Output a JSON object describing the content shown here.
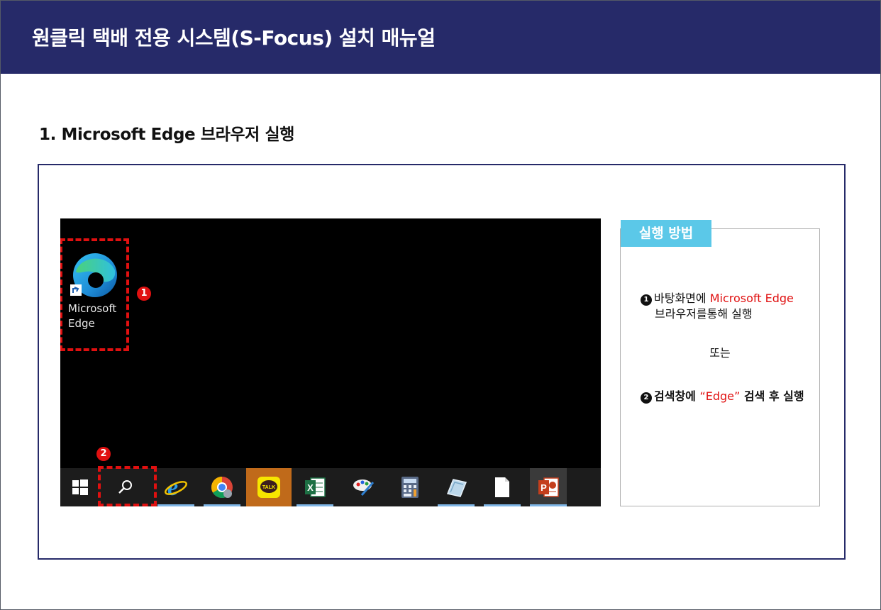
{
  "header": {
    "title": "원클릭 택배 전용 시스템(S-Focus) 설치 매뉴얼"
  },
  "section": {
    "title": "1. Microsoft Edge 브라우저 실행"
  },
  "desktop": {
    "shortcut_label": "Microsoft\nEdge",
    "marker1": "1",
    "marker2": "2"
  },
  "taskbar": {
    "items": [
      "windows-start",
      "search",
      "internet-explorer",
      "chrome",
      "kakaotalk",
      "excel",
      "paint",
      "calculator",
      "notes",
      "notepad",
      "powerpoint"
    ],
    "kakao_label": "TALK",
    "excel_letter": "X",
    "ppt_letter": "P"
  },
  "info": {
    "tab_label": "실행 방법",
    "step1_num": "1",
    "step1_prefix": "바탕화면에 ",
    "step1_highlight": "Microsoft Edge",
    "step1_suffix": "브라우저를통해 실행",
    "or_text": "또는",
    "step2_num": "2",
    "step2_prefix": "검색창에 ",
    "step2_highlight": "“Edge”",
    "step2_suffix": " 검색 후 실행"
  },
  "colors": {
    "header_bg": "#262a69",
    "accent_red": "#e01010",
    "tab_blue": "#5bc8e8"
  }
}
